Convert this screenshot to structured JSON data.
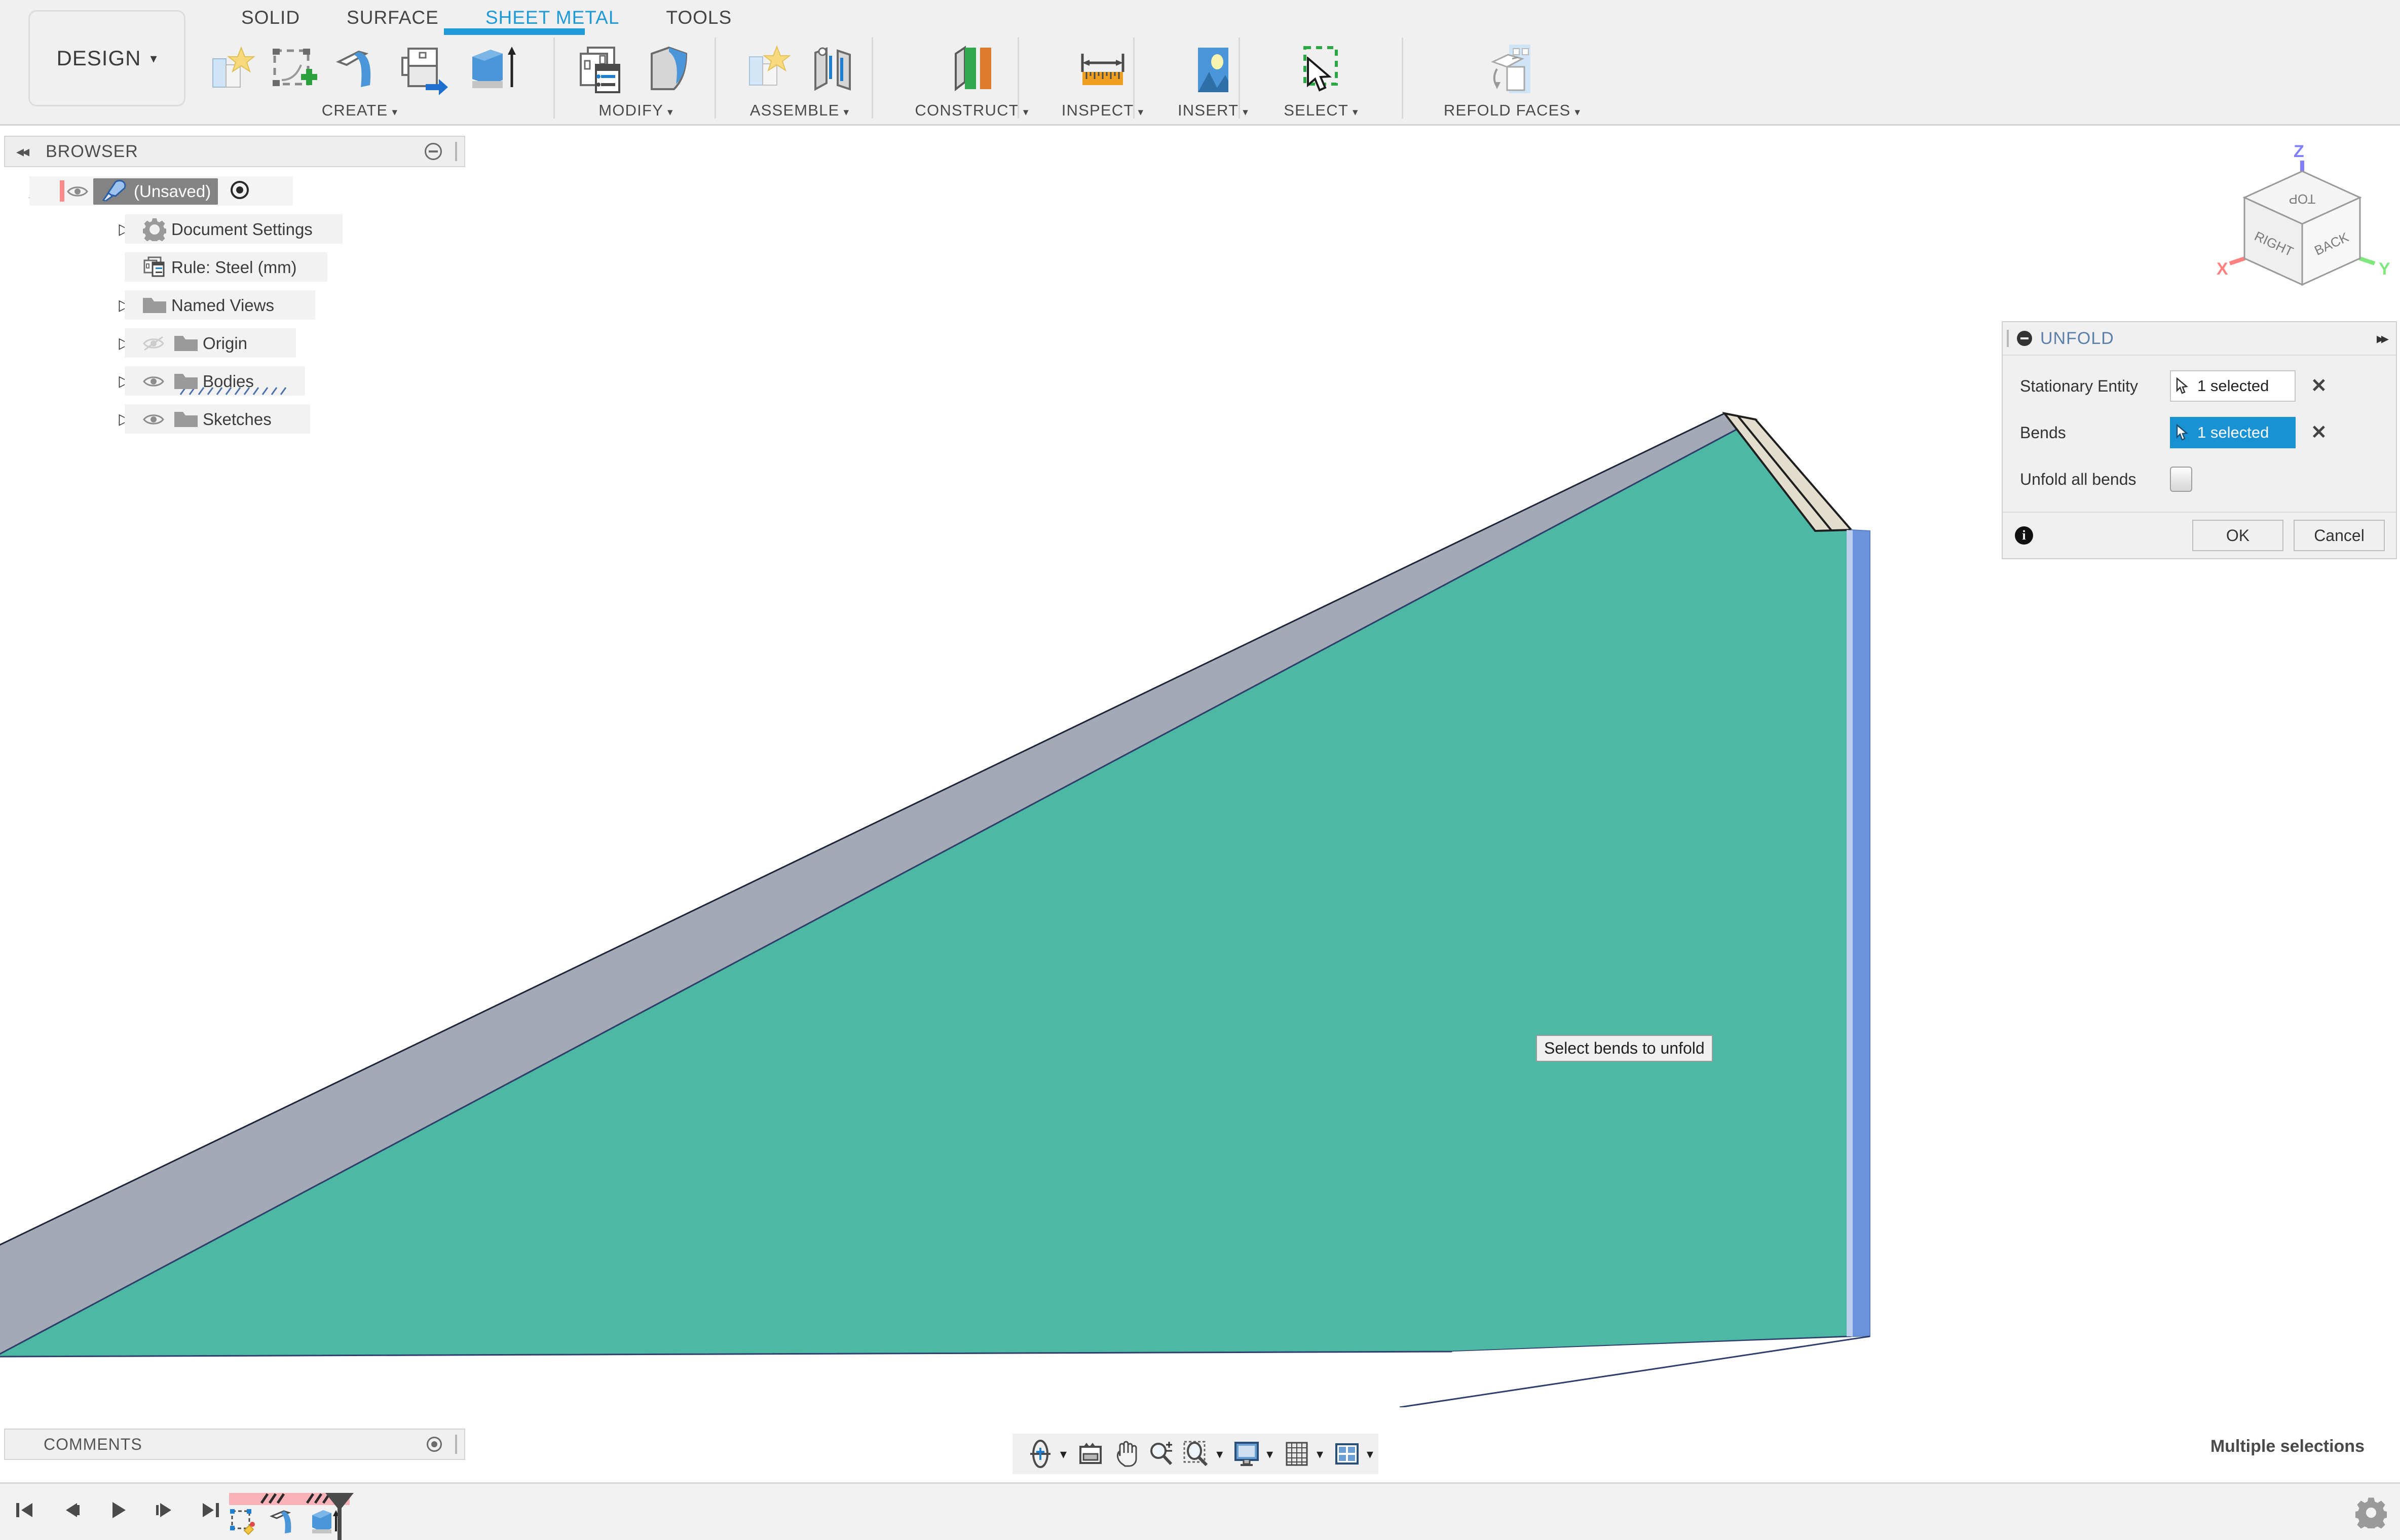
{
  "app": {
    "workspace_label": "DESIGN",
    "workspace_caret": "▾"
  },
  "tabs": [
    {
      "label": "SOLID",
      "active": false
    },
    {
      "label": "SURFACE",
      "active": false
    },
    {
      "label": "SHEET METAL",
      "active": true
    },
    {
      "label": "TOOLS",
      "active": false
    }
  ],
  "ribbon_groups": [
    {
      "label": "CREATE",
      "caret": "▾",
      "icons": [
        "new-sheet-metal-component-icon",
        "create-sketch-icon",
        "flange-icon",
        "flat-pattern-icon",
        "extrude-icon"
      ]
    },
    {
      "label": "MODIFY",
      "caret": "▾",
      "icons": [
        "sheet-metal-rules-icon",
        "bend-icon"
      ]
    },
    {
      "label": "ASSEMBLE",
      "caret": "▾",
      "icons": [
        "new-component-icon",
        "joint-icon"
      ]
    },
    {
      "label": "CONSTRUCT",
      "caret": "▾",
      "icons": [
        "offset-plane-icon"
      ]
    },
    {
      "label": "INSPECT",
      "caret": "▾",
      "icons": [
        "measure-icon"
      ]
    },
    {
      "label": "INSERT",
      "caret": "▾",
      "icons": [
        "insert-image-icon"
      ]
    },
    {
      "label": "SELECT",
      "caret": "▾",
      "icons": [
        "window-selection-icon"
      ]
    },
    {
      "label": "REFOLD FACES",
      "caret": "▾",
      "icons": [
        "refold-faces-icon"
      ]
    }
  ],
  "browser": {
    "title": "BROWSER",
    "collapse_icon": "◂◂",
    "items": [
      {
        "label": "(Unsaved)",
        "icon": "document-icon",
        "arrow": "◢",
        "eye": true,
        "selected": true,
        "indent": 0,
        "target_icon": true,
        "has_red_mark": true
      },
      {
        "label": "Document Settings",
        "icon": "gear-icon",
        "arrow": "▷",
        "eye": false,
        "selected": false,
        "indent": 1
      },
      {
        "label": "Rule: Steel (mm)",
        "icon": "rule-icon",
        "arrow": "",
        "eye": false,
        "selected": false,
        "indent": 1
      },
      {
        "label": "Named Views",
        "icon": "folder-icon",
        "arrow": "▷",
        "eye": false,
        "selected": false,
        "indent": 1
      },
      {
        "label": "Origin",
        "icon": "folder-icon",
        "arrow": "▷",
        "eye": true,
        "eye_off": true,
        "selected": false,
        "indent": 1
      },
      {
        "label": "Bodies",
        "icon": "folder-icon",
        "arrow": "▷",
        "eye": true,
        "selected": false,
        "indent": 1
      },
      {
        "label": "Sketches",
        "icon": "folder-icon",
        "arrow": "▷",
        "eye": true,
        "selected": false,
        "indent": 1
      }
    ]
  },
  "unfold_dialog": {
    "title": "UNFOLD",
    "minimize_icon": "minimize-icon",
    "expand_icon": "▸▸",
    "rows": [
      {
        "label": "Stationary Entity",
        "value": "1 selected",
        "active": false,
        "clear_icon": "✕"
      },
      {
        "label": "Bends",
        "value": "1 selected",
        "active": true,
        "clear_icon": "✕"
      }
    ],
    "checkbox_row": {
      "label": "Unfold all bends",
      "checked": false
    },
    "info_icon": "info-icon",
    "ok_label": "OK",
    "cancel_label": "Cancel"
  },
  "viewport": {
    "tooltip": "Select bends to unfold",
    "status": "Multiple selections",
    "colors": {
      "front_face": "#4db8a4",
      "top_band": "#a3a9b5",
      "bend_face_highlight": "#6b93de",
      "bend_face_light": "#bcd0ee",
      "end_face": "#e2ddcc",
      "background": "#ffffff"
    }
  },
  "viewcube": {
    "faces": {
      "top": "TOP",
      "front_left": "RIGHT",
      "front_right": "BACK"
    },
    "axes": {
      "x": "X",
      "y": "Y",
      "z": "Z"
    },
    "axis_colors": {
      "x": "#ff8080",
      "y": "#7ee87e",
      "z": "#8080ff"
    }
  },
  "nav_toolbar": {
    "items": [
      {
        "icon": "orbit-icon",
        "caret": "▾"
      },
      {
        "icon": "look-at-icon",
        "caret": ""
      },
      {
        "icon": "pan-icon",
        "caret": ""
      },
      {
        "icon": "zoom-icon",
        "caret": ""
      },
      {
        "icon": "zoom-window-icon",
        "caret": "▾"
      },
      {
        "icon": "display-settings-icon",
        "caret": "▾"
      },
      {
        "icon": "grid-snap-icon",
        "caret": "▾"
      },
      {
        "icon": "viewports-icon",
        "caret": "▾"
      }
    ]
  },
  "comments": {
    "title": "COMMENTS"
  },
  "timeline": {
    "playback": [
      "skip-to-start-icon",
      "step-back-icon",
      "play-icon",
      "step-forward-icon",
      "skip-to-end-icon"
    ],
    "features": [
      "sketch-feature-icon",
      "flange-feature-icon",
      "extrude-feature-icon"
    ],
    "marker_icon": "timeline-marker-icon"
  },
  "settings": {
    "gear_icon": "gear-icon"
  }
}
